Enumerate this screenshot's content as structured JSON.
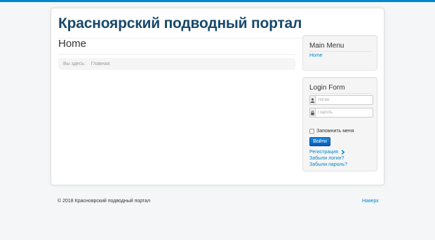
{
  "site": {
    "title": "Красноярский подводный портал"
  },
  "page": {
    "heading": "Home"
  },
  "breadcrumb": {
    "prefix": "Вы здесь:",
    "current": "Главная"
  },
  "main_menu": {
    "title": "Main Menu",
    "items": [
      {
        "label": "Home"
      }
    ]
  },
  "login_form": {
    "title": "Login Form",
    "username_placeholder": "Логин",
    "password_placeholder": "Пароль",
    "remember_label": "Запомнить меня",
    "submit_label": "Войти",
    "register_link": "Регистрация",
    "forgot_login_link": "Забыли логин?",
    "forgot_password_link": "Забыли пароль?"
  },
  "footer": {
    "copyright": "© 2018 Красноярский подводный портал",
    "back_to_top": "Наверх"
  },
  "colors": {
    "accent": "#0088cc",
    "title": "#17496b",
    "button": "#0a58b5",
    "background": "#f4f6f7"
  },
  "icons": {
    "username": "user-icon",
    "password": "lock-icon",
    "register_chevron": "chevron-right-icon"
  }
}
